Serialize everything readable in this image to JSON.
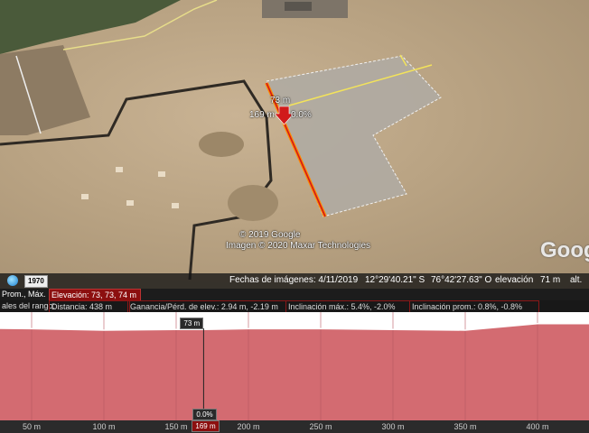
{
  "map": {
    "credit_line1": "© 2019 Google",
    "credit_line2": "Imagen © 2020 Maxar Technologies",
    "logo_text": "Goog",
    "path_elevation_label": "73 m",
    "path_distance_label": "169 m",
    "path_grade_label": "0.0%"
  },
  "status": {
    "year_badge": "1970",
    "imagery_date": "Fechas de imágenes: 4/11/2019",
    "latitude": "12°29'40.21\" S",
    "longitude": "76°42'27.63\" O",
    "elevation_label": "elevación",
    "elevation_value": "71 m",
    "altitude_label": "alt."
  },
  "stats_row1": {
    "left_label": "Prom., Máx.",
    "elevation": "Elevación: 73, 73, 74 m"
  },
  "stats_row2": {
    "range_label": "ales del rango:",
    "distance": "Distancia: 438 m",
    "gain_loss": "Ganancia/Pérd. de elev.: 2.94 m, -2.19 m",
    "max_slope": "Inclinación máx.: 5.4%, -2.0%",
    "avg_slope": "Inclinación prom.: 0.8%, -0.8%"
  },
  "profile": {
    "cursor_elevation": "73 m",
    "cursor_grade": "0.0%",
    "cursor_distance": "169 m",
    "x_ticks": [
      "50 m",
      "100 m",
      "150 m",
      "200 m",
      "250 m",
      "300 m",
      "350 m",
      "400 m"
    ],
    "fill_color": "#d36b71",
    "line_color": "#ffffff",
    "highlight_color": "#c0101c"
  },
  "chart_data": {
    "type": "area",
    "x": [
      0,
      50,
      100,
      150,
      169,
      200,
      250,
      300,
      350,
      400,
      438
    ],
    "values": [
      72.8,
      72.7,
      72.5,
      72.6,
      72.6,
      72.7,
      72.7,
      72.6,
      72.5,
      73.4,
      73.4
    ],
    "xlabel": "",
    "ylabel": "",
    "xlim": [
      0,
      438
    ],
    "ylim": [
      60,
      75
    ]
  }
}
